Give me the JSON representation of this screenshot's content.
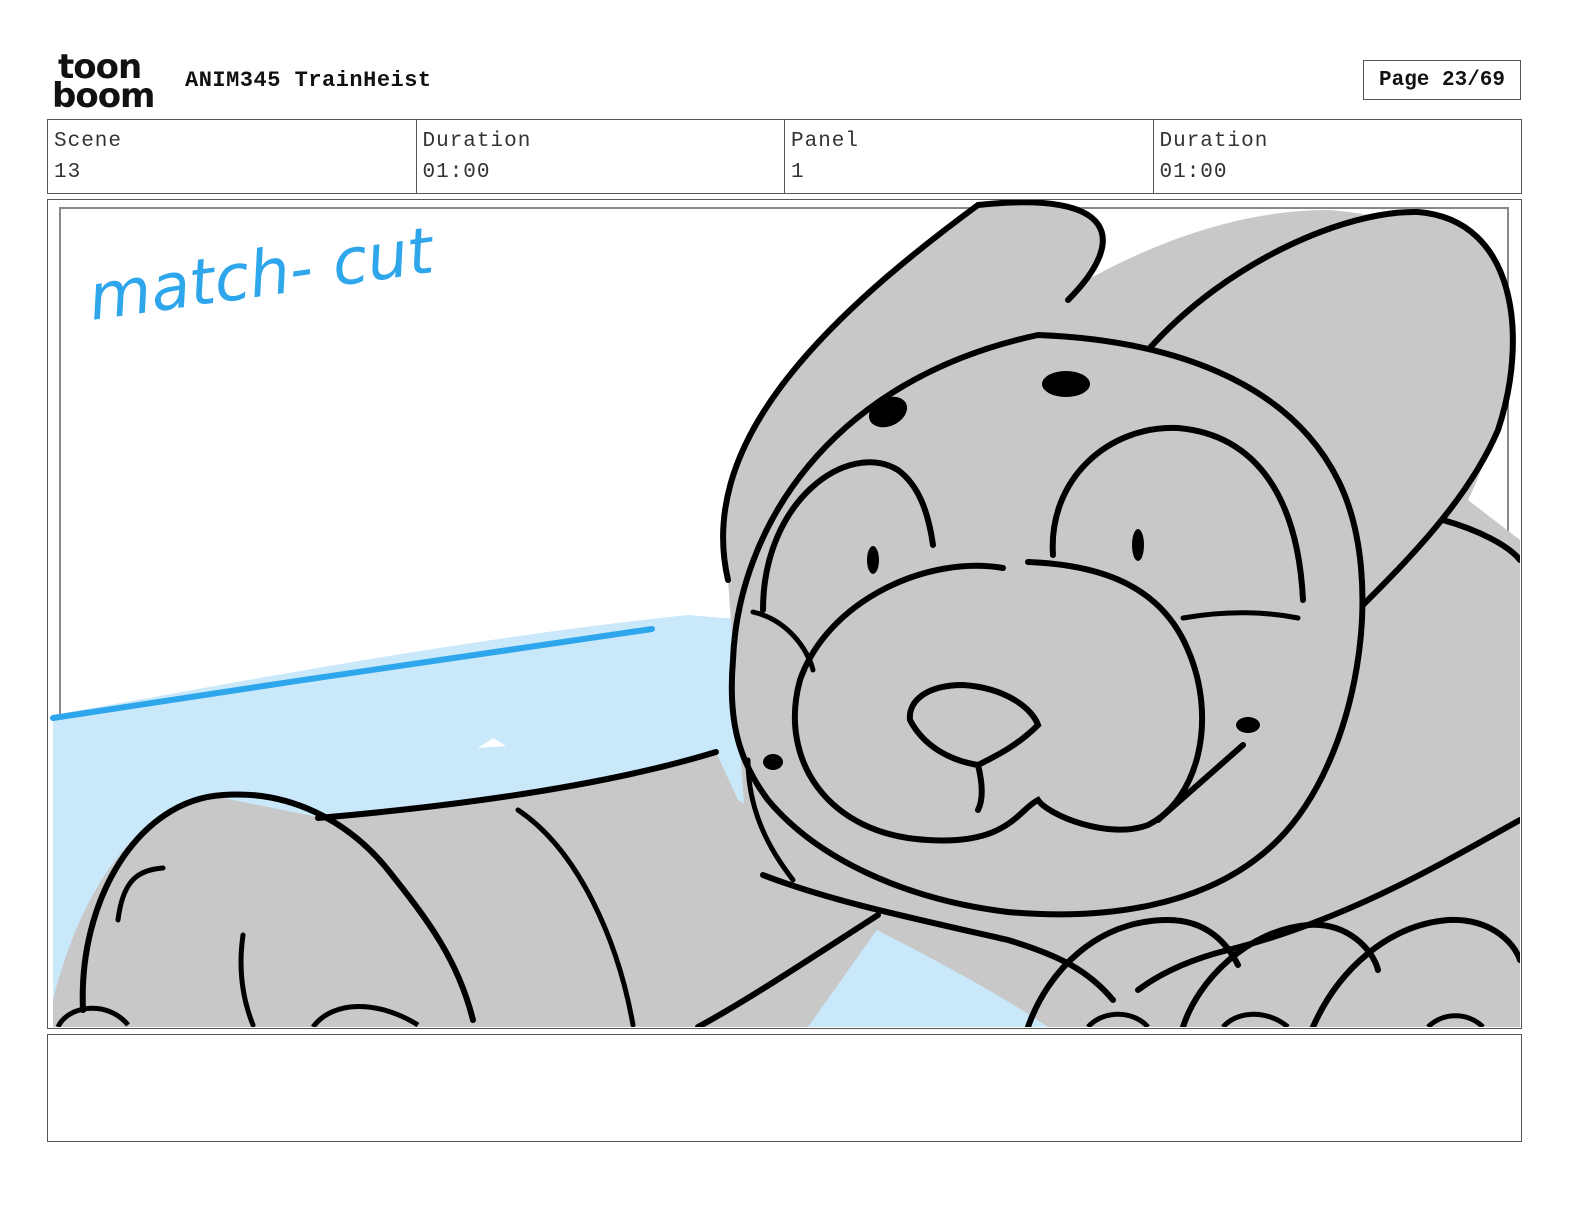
{
  "header": {
    "logo_line1": "toon",
    "logo_line2": "boom",
    "project_title": "ANIM345 TrainHeist",
    "page_label": "Page 23/69"
  },
  "info": {
    "scene_label": "Scene",
    "scene_value": "13",
    "scene_duration_label": "Duration",
    "scene_duration_value": "01:00",
    "panel_label": "Panel",
    "panel_value": "1",
    "panel_duration_label": "Duration",
    "panel_duration_value": "01:00"
  },
  "panel": {
    "annotation": "match- cut",
    "colors": {
      "annotation": "#2ea6ec",
      "water": "#c9e8fa",
      "character_fill": "#c8c8c8",
      "line": "#000000"
    }
  },
  "notes": {
    "text": ""
  }
}
